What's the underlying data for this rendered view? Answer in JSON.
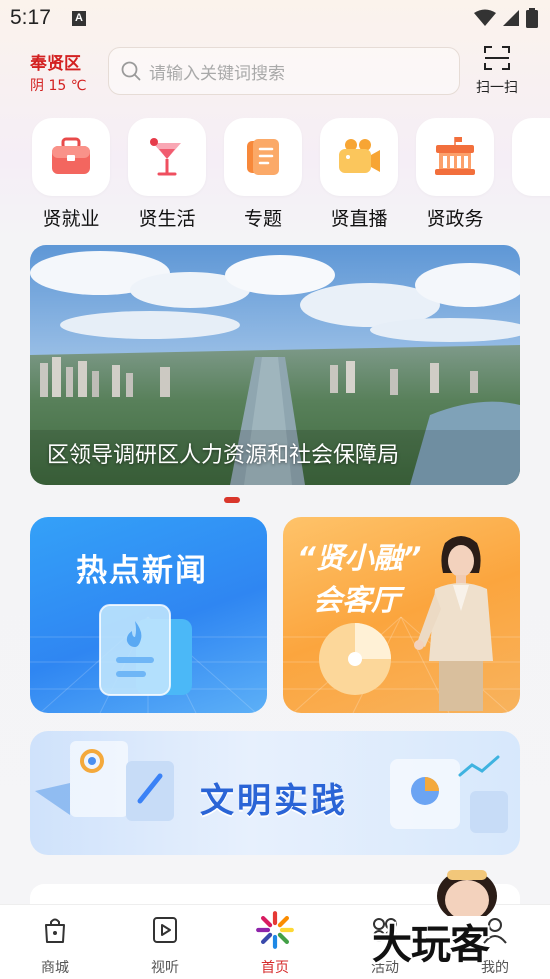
{
  "status_bar": {
    "time": "5:17",
    "notification_letter": "A"
  },
  "header": {
    "location": "奉贤区",
    "weather": "阴 15 ℃",
    "search_placeholder": "请输入关键词搜索",
    "scan_label": "扫一扫"
  },
  "quick_entries": [
    {
      "label": "贤就业",
      "icon": "briefcase-icon"
    },
    {
      "label": "贤生活",
      "icon": "cocktail-icon"
    },
    {
      "label": "专题",
      "icon": "document-icon"
    },
    {
      "label": "贤直播",
      "icon": "camera-icon"
    },
    {
      "label": "贤政务",
      "icon": "government-icon"
    }
  ],
  "banner": {
    "title": "区领导调研区人力资源和社会保障局",
    "pages": 1,
    "active_page": 1
  },
  "cards": {
    "hot_news": "热点新闻",
    "hall_line1": "“贤小融”",
    "hall_line2": "会客厅",
    "civilization": "文明实践"
  },
  "tabbar": [
    {
      "label": "商城",
      "icon": "shopping-bag-icon",
      "active": false
    },
    {
      "label": "视听",
      "icon": "play-icon",
      "active": false
    },
    {
      "label": "首页",
      "icon": "home-logo-icon",
      "active": true
    },
    {
      "label": "活动",
      "icon": "activity-icon",
      "active": false
    },
    {
      "label": "我的",
      "icon": "profile-icon",
      "active": false
    }
  ],
  "watermark": "大玩客",
  "colors": {
    "accent": "#d32121",
    "hot_news": "#2f86f2",
    "hall": "#fba53e",
    "civilization": "#2a64d6"
  }
}
